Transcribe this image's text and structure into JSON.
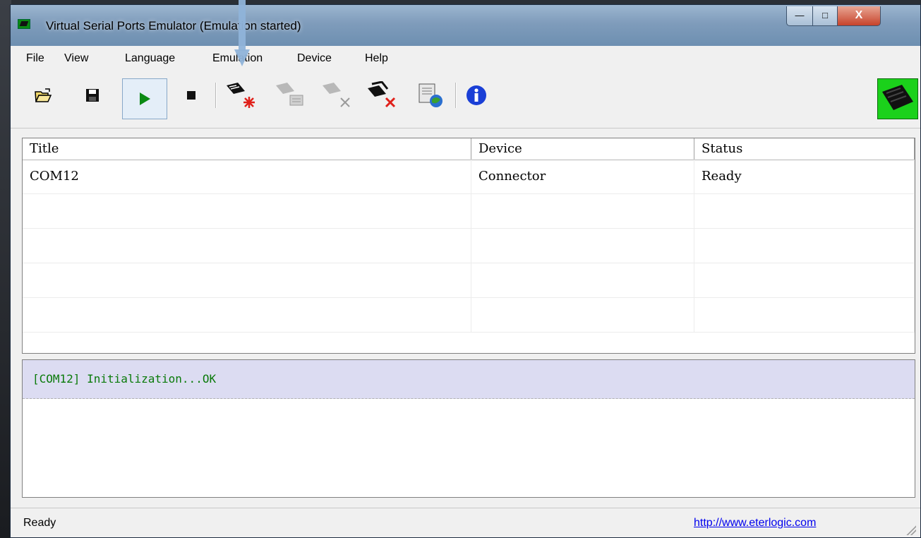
{
  "window": {
    "title": "Virtual Serial Ports Emulator (Emulation started)",
    "controls": {
      "minimize": "—",
      "maximize": "□",
      "close": "X"
    }
  },
  "menu": [
    "File",
    "View",
    "Language",
    "Emulation",
    "Device",
    "Help"
  ],
  "toolbar": {
    "buttons": [
      {
        "name": "open-icon",
        "pressed": false
      },
      {
        "name": "save-icon",
        "pressed": false
      },
      {
        "name": "start-emulation-icon",
        "pressed": true
      },
      {
        "name": "stop-emulation-icon",
        "pressed": false
      },
      {
        "name": "create-device-icon",
        "pressed": false
      },
      {
        "name": "edit-device-icon",
        "pressed": false
      },
      {
        "name": "delete-device-icon",
        "pressed": false
      },
      {
        "name": "delete-all-devices-icon",
        "pressed": false
      },
      {
        "name": "network-settings-icon",
        "pressed": false
      },
      {
        "name": "info-icon",
        "pressed": false
      }
    ]
  },
  "grid": {
    "columns": [
      "Title",
      "Device",
      "Status"
    ],
    "rows": [
      [
        "COM12",
        "Connector",
        "Ready"
      ],
      [
        "",
        "",
        ""
      ],
      [
        "",
        "",
        ""
      ],
      [
        "",
        "",
        ""
      ],
      [
        "",
        "",
        ""
      ]
    ]
  },
  "log": {
    "lines": [
      "[COM12] Initialization...OK"
    ]
  },
  "status": {
    "text": "Ready",
    "link": "http://www.eterlogic.com"
  },
  "colors": {
    "log_text": "#0a7a0a",
    "log_highlight": "#dcdcf2",
    "link": "#0000ee",
    "annotation_arrow": "#8fb3d9"
  }
}
